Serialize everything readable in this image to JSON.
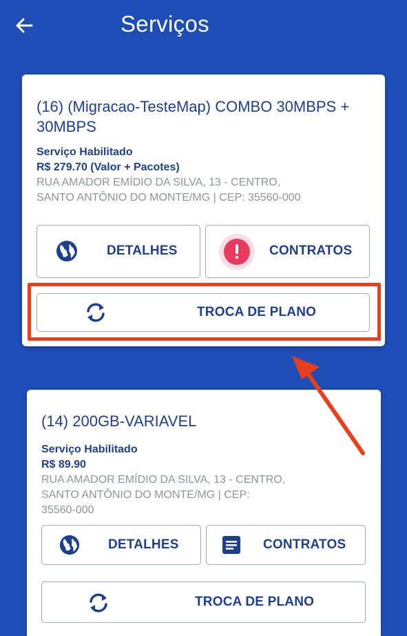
{
  "header": {
    "title": "Serviços",
    "back_icon": "arrow-left-icon"
  },
  "services": [
    {
      "title": "(16) (Migracao-TesteMap) COMBO 30MBPS + 30MBPS",
      "status": "Serviço Habilitado",
      "price": "R$ 279.70 (Valor + Pacotes)",
      "address_line1": "RUA AMADOR EMÍDIO DA SILVA, 13 - CENTRO,",
      "address_line2": "SANTO ANTÔNIO DO MONTE/MG | CEP: 35560-000",
      "details_label": "DETALHES",
      "contracts_label": "CONTRATOS",
      "contracts_icon": "alert-icon",
      "change_plan_label": "TROCA DE PLANO"
    },
    {
      "title": "(14) 200GB-VARIAVEL",
      "status": "Serviço Habilitado",
      "price": "R$ 89.90",
      "address_line1": "RUA AMADOR EMÍDIO DA SILVA, 13 - CENTRO,",
      "address_line2": "SANTO ANTÔNIO DO MONTE/MG | CEP:",
      "address_line3": "35560-000",
      "details_label": "DETALHES",
      "contracts_label": "CONTRATOS",
      "contracts_icon": "document-icon",
      "change_plan_label": "TROCA DE PLANO"
    }
  ],
  "colors": {
    "background": "#1f4db8",
    "primary_text": "#1c3f8f",
    "muted_text": "#8f949c",
    "alert": "#e8395f",
    "highlight": "#e8401c"
  }
}
